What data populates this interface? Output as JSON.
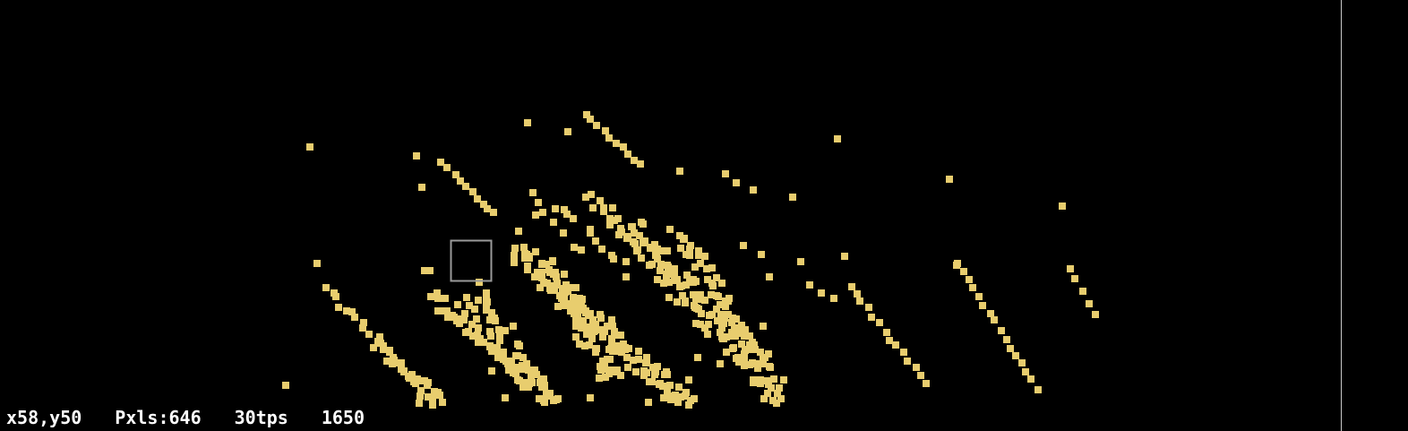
{
  "status": {
    "coords": "x58,y50",
    "pixels": "Pxls:646",
    "fps": "30tps",
    "ticks": "1650"
  },
  "colors": {
    "background": "#000000",
    "sand": "#e8cd6e",
    "cursor": "#9a9a9a",
    "status_text": "#ffffff",
    "border": "#c8c8c8"
  },
  "cursor": {
    "x": 58,
    "y": 50
  }
}
